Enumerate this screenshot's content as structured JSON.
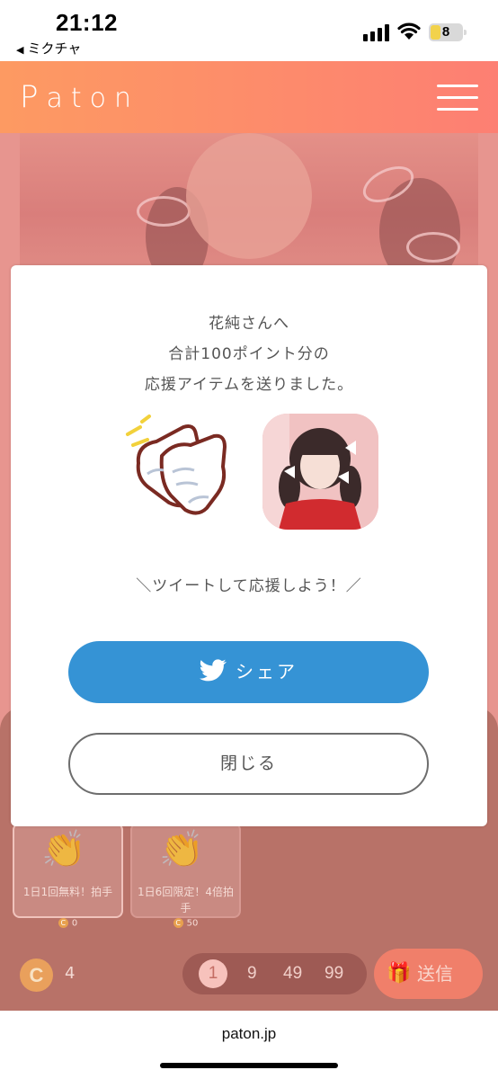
{
  "status_bar": {
    "time": "21:12",
    "back_app": "ミクチャ",
    "battery": "8"
  },
  "header": {
    "logo": "Paton",
    "menu_icon": "hamburger-menu-icon"
  },
  "modal": {
    "message_lines": [
      "花純さんへ",
      "合計100ポイント分の",
      "応援アイテムを送りました。"
    ],
    "tweet_prompt": "＼ツイートして応援しよう！／",
    "share_label": "シェア",
    "close_label": "閉じる",
    "share_icon": "twitter-bird-icon",
    "item_icon": "clapping-gloves-icon"
  },
  "background": {
    "items": [
      {
        "name": "1日1回無料！拍手",
        "cost": "0"
      },
      {
        "name": "1日6回限定！4倍拍手",
        "cost": "50"
      }
    ],
    "coin_symbol": "C",
    "balance": "4",
    "quantities": [
      "1",
      "9",
      "49",
      "99"
    ],
    "selected_quantity": "1",
    "send_label": "送信"
  },
  "browser": {
    "url": "paton.jp"
  },
  "colors": {
    "header_gradient_start": "#fd9a62",
    "header_gradient_end": "#fd7f73",
    "share_button": "#3593d5",
    "send_button": "#f07f6a"
  }
}
